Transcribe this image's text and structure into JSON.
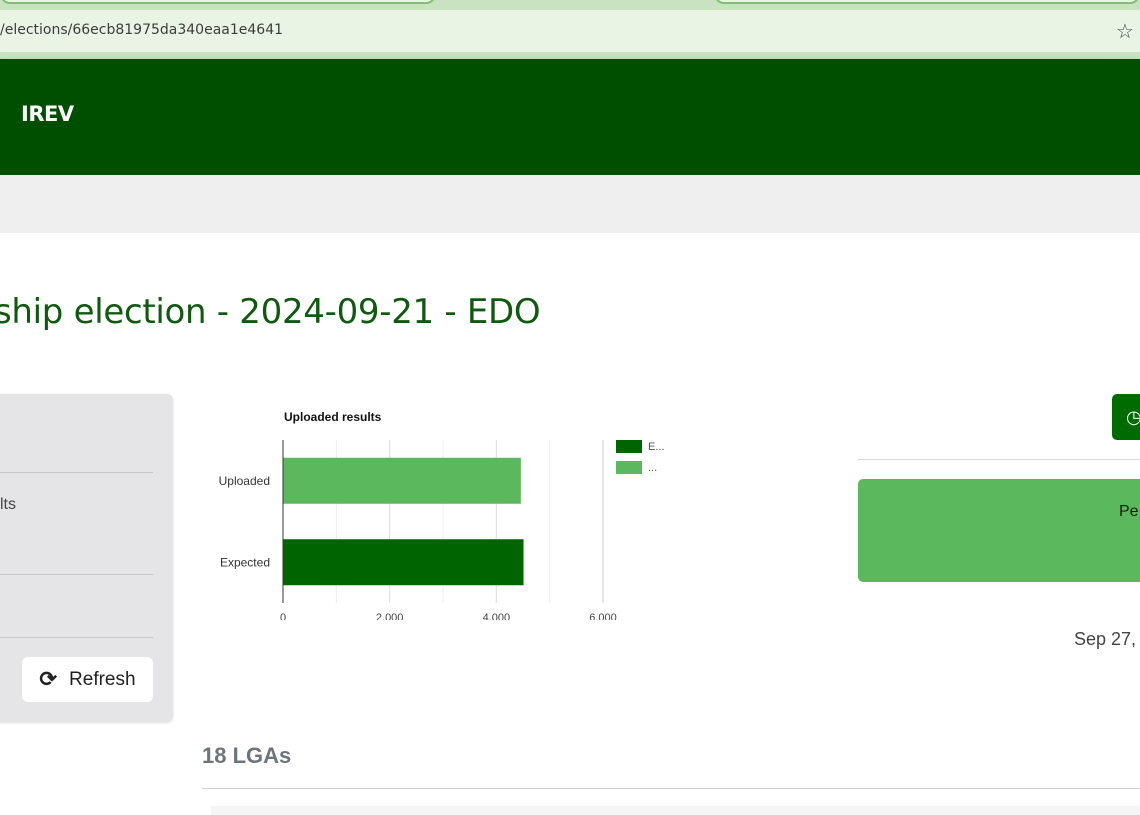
{
  "browser": {
    "url": "/elections/66ecb81975da340eaa1e4641",
    "bookmark_icon": "star-icon"
  },
  "header": {
    "brand": "IREV",
    "color": "#004f00"
  },
  "page": {
    "title": "ship election - 2024-09-21 - EDO"
  },
  "left_panel": {
    "items": [
      "lts"
    ],
    "refresh_label": "Refresh",
    "refresh_icon": "refresh-icon"
  },
  "chart_data": {
    "type": "bar",
    "orientation": "horizontal",
    "title": "Uploaded results",
    "categories": [
      "Uploaded",
      "Expected"
    ],
    "series": [
      {
        "name": "E...",
        "values": [
          null,
          4510
        ],
        "color": "#006400"
      },
      {
        "name": "...",
        "values": [
          4460,
          null
        ],
        "color": "#5cb85c"
      }
    ],
    "xlim": [
      0,
      6000
    ],
    "xticks": [
      "0",
      "2,000",
      "4,000",
      "6,000"
    ],
    "grid": true,
    "legend": "right"
  },
  "right_panel": {
    "clock_icon": "clock-icon",
    "status_text": "Pe",
    "status_color": "#5cb85c",
    "date_text": "Sep 27,"
  },
  "lga": {
    "heading": "18 LGAs"
  }
}
